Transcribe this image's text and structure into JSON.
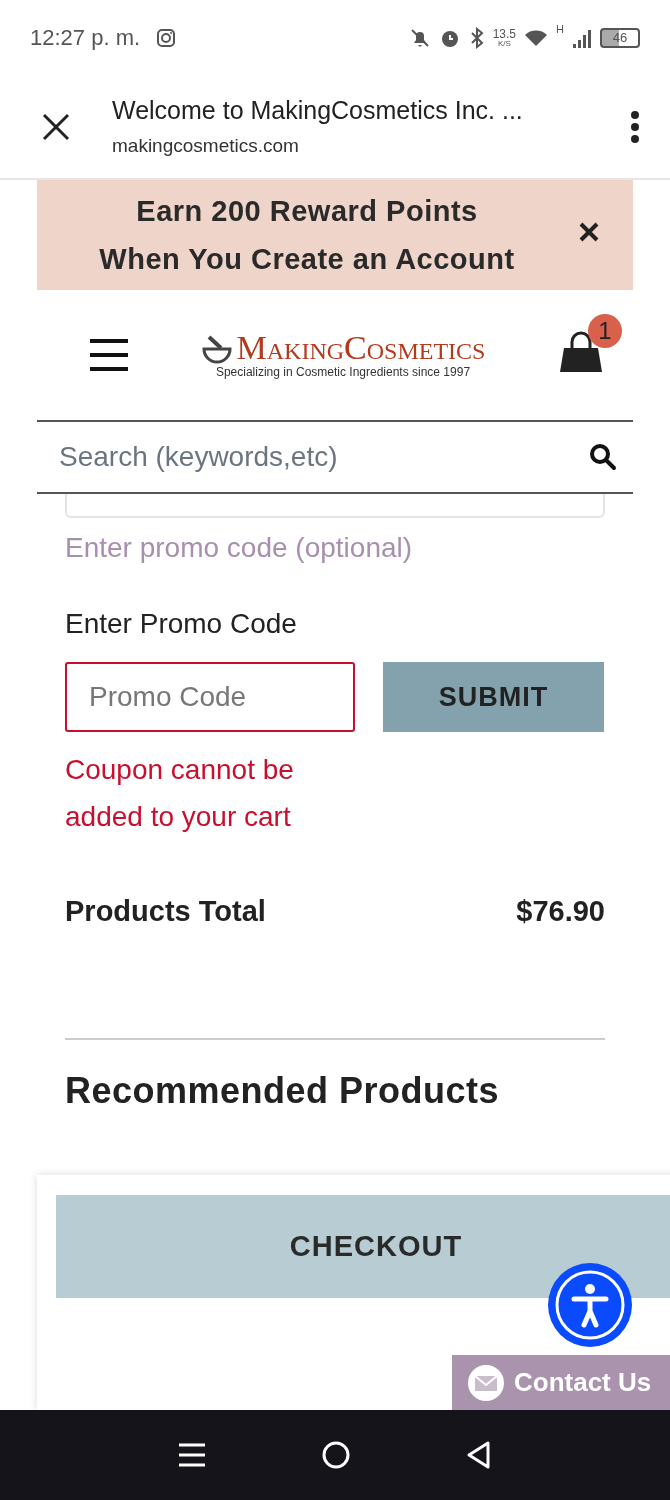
{
  "status_bar": {
    "time": "12:27 p. m.",
    "net_speed": "13.5",
    "net_speed_unit": "K/S",
    "network": "H",
    "battery": "46"
  },
  "browser": {
    "title": "Welcome to MakingCosmetics Inc. ...",
    "url": "makingcosmetics.com"
  },
  "banner": {
    "lines": [
      "Earn 200 Reward Points",
      "When You Create an Account"
    ]
  },
  "header": {
    "logo_name": "MakingCosmetics",
    "tagline": "Specializing in Cosmetic Ingredients since 1997",
    "cart_count": "1"
  },
  "search": {
    "placeholder": "Search (keywords,etc)"
  },
  "promo": {
    "link": "Enter promo code (optional)",
    "label": "Enter Promo Code",
    "placeholder": "Promo Code",
    "invalid": true,
    "button": "SUBMIT",
    "error": "Coupon cannot be added to your cart"
  },
  "totals": {
    "label": "Products Total",
    "value": "$76.90"
  },
  "recommended": {
    "title": "Recommended Products"
  },
  "checkout": {
    "button": "CHECKOUT"
  },
  "contact": {
    "label": "Contact Us"
  }
}
